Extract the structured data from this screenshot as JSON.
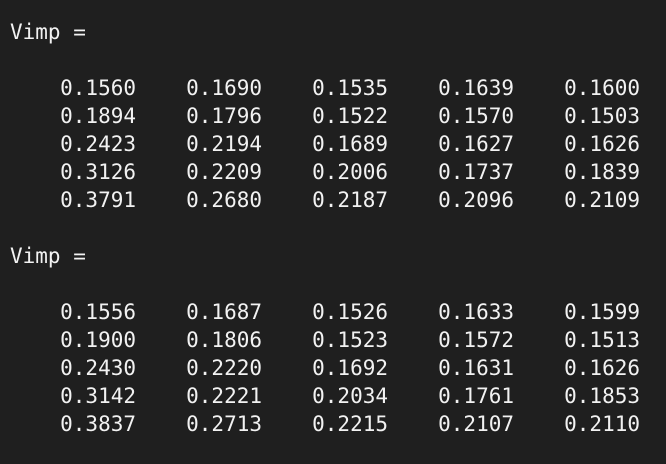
{
  "theme": {
    "background": "#1f1f1f",
    "text_color": "#f2f2f2"
  },
  "outputs": [
    {
      "header": "Vimp =",
      "rows": [
        [
          "0.1560",
          "0.1690",
          "0.1535",
          "0.1639",
          "0.1600"
        ],
        [
          "0.1894",
          "0.1796",
          "0.1522",
          "0.1570",
          "0.1503"
        ],
        [
          "0.2423",
          "0.2194",
          "0.1689",
          "0.1627",
          "0.1626"
        ],
        [
          "0.3126",
          "0.2209",
          "0.2006",
          "0.1737",
          "0.1839"
        ],
        [
          "0.3791",
          "0.2680",
          "0.2187",
          "0.2096",
          "0.2109"
        ]
      ]
    },
    {
      "header": "Vimp =",
      "rows": [
        [
          "0.1556",
          "0.1687",
          "0.1526",
          "0.1633",
          "0.1599"
        ],
        [
          "0.1900",
          "0.1806",
          "0.1523",
          "0.1572",
          "0.1513"
        ],
        [
          "0.2430",
          "0.2220",
          "0.1692",
          "0.1631",
          "0.1626"
        ],
        [
          "0.3142",
          "0.2221",
          "0.2034",
          "0.1761",
          "0.1853"
        ],
        [
          "0.3837",
          "0.2713",
          "0.2215",
          "0.2107",
          "0.2110"
        ]
      ]
    }
  ]
}
